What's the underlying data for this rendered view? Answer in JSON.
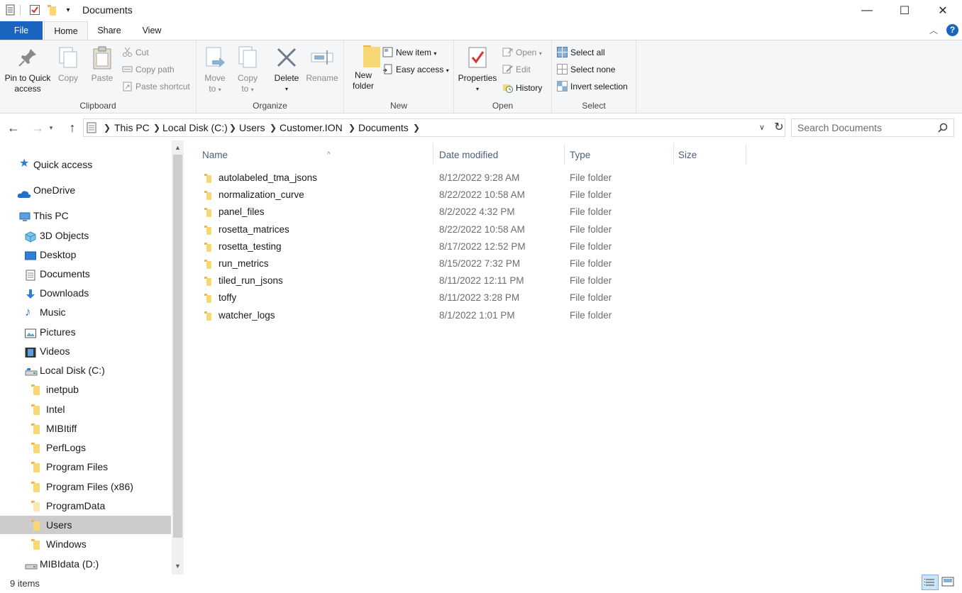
{
  "window": {
    "title": "Documents",
    "minimize_glyph": "—",
    "maximize_glyph": "☐",
    "close_glyph": "✕"
  },
  "ribbon_tabs": {
    "file": "File",
    "home": "Home",
    "share": "Share",
    "view": "View"
  },
  "ribbon": {
    "clipboard": {
      "label": "Clipboard",
      "pin_line1": "Pin to Quick",
      "pin_line2": "access",
      "copy": "Copy",
      "paste": "Paste",
      "cut": "Cut",
      "copy_path": "Copy path",
      "paste_shortcut": "Paste shortcut"
    },
    "organize": {
      "label": "Organize",
      "move_line1": "Move",
      "move_line2": "to",
      "copy_line1": "Copy",
      "copy_line2": "to",
      "delete": "Delete",
      "rename": "Rename"
    },
    "new": {
      "label": "New",
      "new_folder_line1": "New",
      "new_folder_line2": "folder",
      "new_item": "New item",
      "easy_access": "Easy access"
    },
    "open": {
      "label": "Open",
      "properties": "Properties",
      "open": "Open",
      "edit": "Edit",
      "history": "History"
    },
    "select": {
      "label": "Select",
      "select_all": "Select all",
      "select_none": "Select none",
      "invert_selection": "Invert selection"
    }
  },
  "address": {
    "crumbs": [
      "This PC",
      "Local Disk (C:)",
      "Users",
      "Customer.ION",
      "Documents"
    ],
    "search_placeholder": "Search Documents"
  },
  "nav": {
    "items": [
      {
        "label": "Quick access"
      },
      {
        "label": "OneDrive"
      },
      {
        "label": "This PC"
      },
      {
        "label": "3D Objects"
      },
      {
        "label": "Desktop"
      },
      {
        "label": "Documents"
      },
      {
        "label": "Downloads"
      },
      {
        "label": "Music"
      },
      {
        "label": "Pictures"
      },
      {
        "label": "Videos"
      },
      {
        "label": "Local Disk (C:)"
      },
      {
        "label": "inetpub"
      },
      {
        "label": "Intel"
      },
      {
        "label": "MIBItiff"
      },
      {
        "label": "PerfLogs"
      },
      {
        "label": "Program Files"
      },
      {
        "label": "Program Files (x86)"
      },
      {
        "label": "ProgramData"
      },
      {
        "label": "Users"
      },
      {
        "label": "Windows"
      },
      {
        "label": "MIBIdata (D:)"
      }
    ],
    "selected": "Users"
  },
  "columns": {
    "name": "Name",
    "date_modified": "Date modified",
    "type": "Type",
    "size": "Size"
  },
  "files": [
    {
      "name": "autolabeled_tma_jsons",
      "date": "8/12/2022 9:28 AM",
      "type": "File folder"
    },
    {
      "name": "normalization_curve",
      "date": "8/22/2022 10:58 AM",
      "type": "File folder"
    },
    {
      "name": "panel_files",
      "date": "8/2/2022 4:32 PM",
      "type": "File folder"
    },
    {
      "name": "rosetta_matrices",
      "date": "8/22/2022 10:58 AM",
      "type": "File folder"
    },
    {
      "name": "rosetta_testing",
      "date": "8/17/2022 12:52 PM",
      "type": "File folder"
    },
    {
      "name": "run_metrics",
      "date": "8/15/2022 7:32 PM",
      "type": "File folder"
    },
    {
      "name": "tiled_run_jsons",
      "date": "8/11/2022 12:11 PM",
      "type": "File folder"
    },
    {
      "name": "toffy",
      "date": "8/11/2022 3:28 PM",
      "type": "File folder"
    },
    {
      "name": "watcher_logs",
      "date": "8/1/2022 1:01 PM",
      "type": "File folder"
    }
  ],
  "status": {
    "item_count": "9 items"
  },
  "colors": {
    "file_tab": "#1a64c0",
    "folder_yellow": "#f8d775",
    "selection": "#cccccc",
    "header_text": "#4c607a"
  }
}
